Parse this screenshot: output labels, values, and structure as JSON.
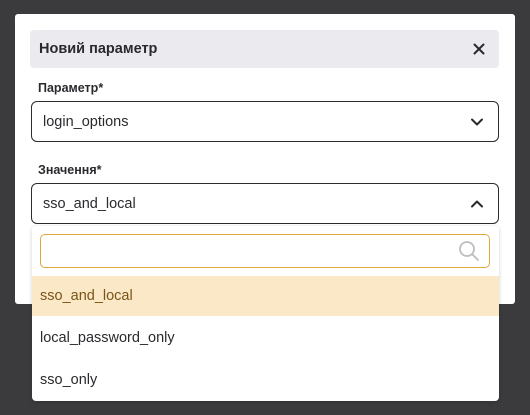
{
  "colors": {
    "backdrop": "#3b3b3d",
    "header_bg": "#ebebef",
    "accent_border": "#e0a83a",
    "selected_option_bg": "#fae8c6",
    "selected_option_text": "#7a5418"
  },
  "modal": {
    "title": "Новий параметр",
    "close_icon": "close-icon"
  },
  "fields": {
    "parameter": {
      "label": "Параметр*",
      "value": "login_options",
      "icon": "chevron-down-icon"
    },
    "value": {
      "label": "Значення*",
      "selected": "sso_and_local",
      "icon": "chevron-up-icon"
    }
  },
  "dropdown": {
    "search_value": "",
    "search_placeholder": "",
    "search_icon": "search-icon",
    "options": [
      {
        "label": "sso_and_local",
        "selected": true
      },
      {
        "label": "local_password_only",
        "selected": false
      },
      {
        "label": "sso_only",
        "selected": false
      }
    ]
  }
}
